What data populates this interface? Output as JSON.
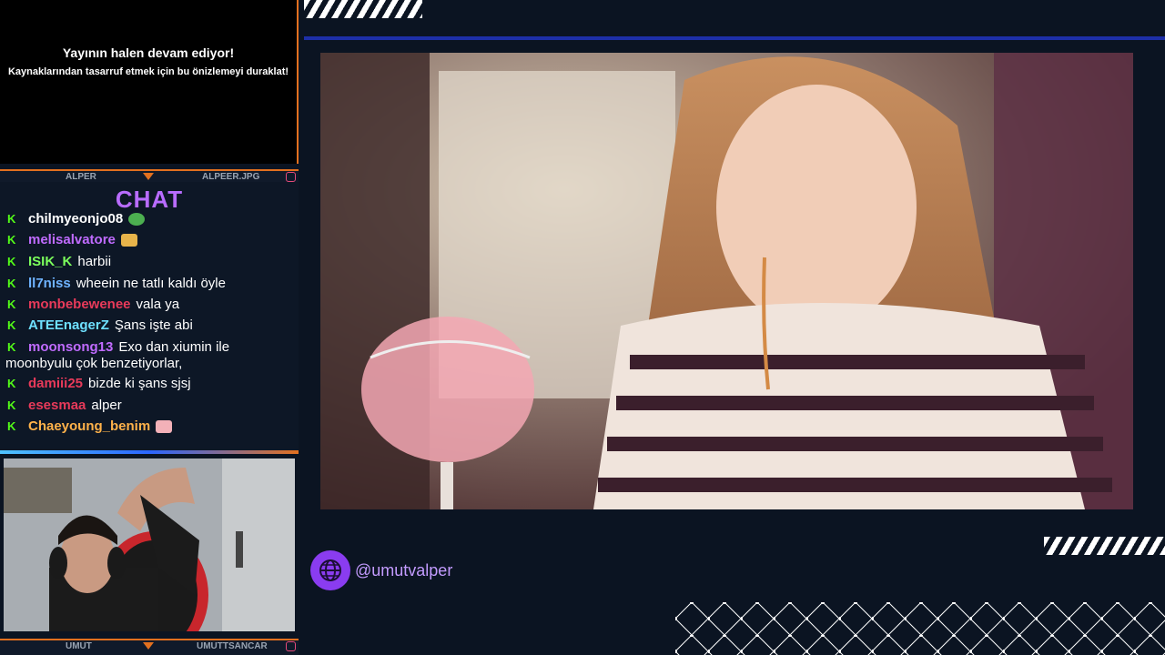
{
  "preview": {
    "line1": "Yayının halen devam ediyor!",
    "line2": "Kaynaklarından tasarruf etmek için bu önizlemeyi duraklat!"
  },
  "top_namebar": {
    "left": "ALPER",
    "right": "ALPEER.JPG"
  },
  "chat": {
    "title": "CHAT",
    "messages": [
      {
        "user": "chilmyeonjo08",
        "text": "",
        "color": "#ffffff"
      },
      {
        "user": "melisalvatore",
        "text": "",
        "color": "#c06bff"
      },
      {
        "user": "ISIK_K",
        "text": "harbii",
        "color": "#7cff5c"
      },
      {
        "user": "ll7niss",
        "text": "wheein ne tatlı kaldı öyle",
        "color": "#6fb3ff"
      },
      {
        "user": "monbebewenee",
        "text": "vala ya",
        "color": "#e83a5a"
      },
      {
        "user": "ATEEnagerZ",
        "text": "Şans işte abi",
        "color": "#6ee0ff"
      },
      {
        "user": "moonsong13",
        "text": "Exo dan xiumin ile moonbyulu çok benzetiyorlar,",
        "color": "#c06bff"
      },
      {
        "user": "damiii25",
        "text": "bizde ki şans sjsj",
        "color": "#e83a5a"
      },
      {
        "user": "esesmaa",
        "text": "alper",
        "color": "#e83a5a"
      },
      {
        "user": "Chaeyoung_benim",
        "text": "",
        "color": "#ffb24a"
      }
    ]
  },
  "bottom_namebar": {
    "left": "UMUT",
    "right": "UMUTTSANCAR"
  },
  "social": {
    "handle": "@umutvalper"
  },
  "colors": {
    "accent_orange": "#e2701f",
    "accent_purple": "#8a3cf0",
    "kick_green": "#53fc18"
  }
}
